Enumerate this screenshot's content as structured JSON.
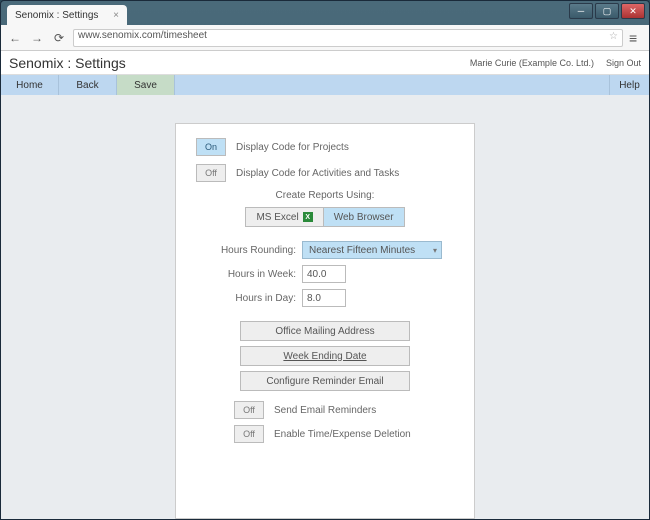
{
  "browser": {
    "tab_title": "Senomix : Settings",
    "url": "www.senomix.com/timesheet"
  },
  "header": {
    "title": "Senomix : Settings",
    "user": "Marie Curie  (Example Co. Ltd.)",
    "signout": "Sign Out"
  },
  "toolbar": {
    "home": "Home",
    "back": "Back",
    "save": "Save",
    "help": "Help"
  },
  "panel": {
    "toggle_on": "On",
    "toggle_off": "Off",
    "display_projects": "Display Code for Projects",
    "display_activities": "Display Code for Activities and Tasks",
    "reports_title": "Create Reports Using:",
    "ms_excel": "MS Excel",
    "web_browser": "Web Browser",
    "hours_rounding_label": "Hours Rounding:",
    "hours_rounding_value": "Nearest Fifteen Minutes",
    "hours_week_label": "Hours in Week:",
    "hours_week_value": "40.0",
    "hours_day_label": "Hours in Day:",
    "hours_day_value": "8.0",
    "office_mailing": "Office Mailing Address",
    "week_ending": "Week Ending Date",
    "configure_reminder": "Configure Reminder Email",
    "send_reminders": "Send Email Reminders",
    "enable_deletion": "Enable Time/Expense Deletion"
  }
}
